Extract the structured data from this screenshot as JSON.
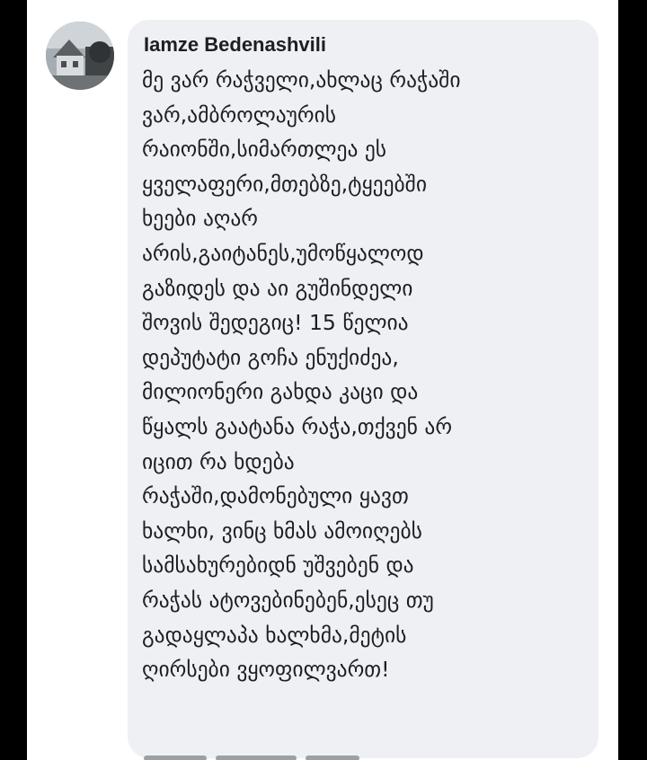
{
  "comment": {
    "author": "Iamze Bedenashvili",
    "lines": [
      "მე ვარ რაჭველი,ახლაც რაჭაში",
      "ვარ,ამბროლაურის",
      "რაიონში,სიმართლეა ეს",
      "ყველაფერი,მთებზე,ტყეებში",
      "ხეები აღარ",
      "არის,გაიტანეს,უმოწყალოდ",
      "გაზიდეს და აი გუშინდელი",
      "შოვის შედეგიც! 15 წელია",
      "დეპუტატი გოჩა ენუქიძეა,",
      "მილიონერი გახდა კაცი და",
      "წყალს გაატანა რაჭა,თქვენ არ",
      "იცით რა ხდება",
      "რაჭაში,დამონებული ყავთ",
      "ხალხი, ვინც ხმას ამოიღებს",
      "სამსახურებიდნ უშვებენ და",
      "რაჭას ატოვებინებენ,ესეც თუ",
      "გადაყლაპა ხალხმა,მეტის",
      "ღირსები ვყოფილვართ!"
    ]
  },
  "colors": {
    "background": "#000000",
    "page": "#ffffff",
    "bubble": "#eef0f3",
    "text": "#1c1e21"
  },
  "icons": {
    "avatar": "profile-photo"
  }
}
